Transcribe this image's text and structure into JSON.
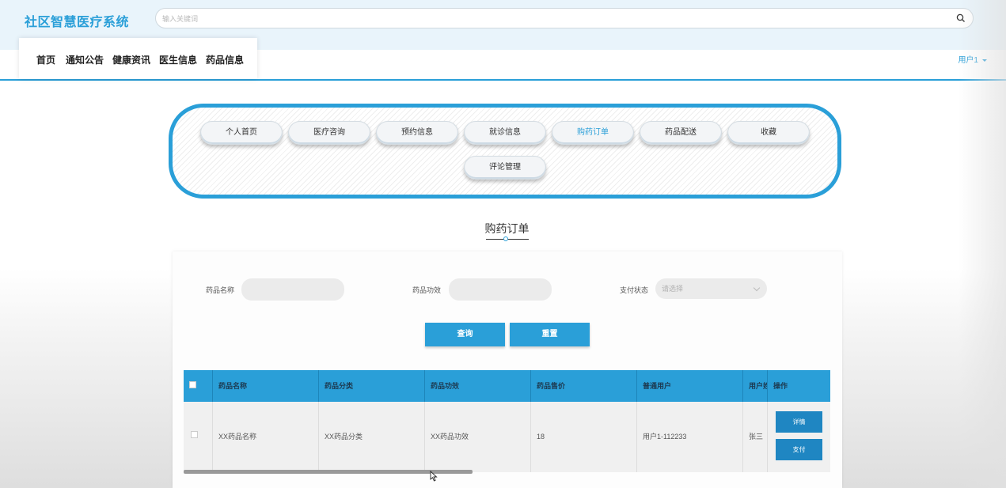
{
  "header": {
    "logo": "社区智慧医疗系统",
    "search_placeholder": "输入关键词"
  },
  "nav": {
    "items": [
      "首页",
      "通知公告",
      "健康资讯",
      "医生信息",
      "药品信息"
    ],
    "user": "用户1"
  },
  "menu": {
    "items": [
      "个人首页",
      "医疗咨询",
      "预约信息",
      "就诊信息",
      "购药订单",
      "药品配送",
      "收藏",
      "评论管理"
    ],
    "active": "购药订单"
  },
  "section_title": "购药订单",
  "filters": {
    "name_label": "药品名称",
    "effect_label": "药品功效",
    "pay_label": "支付状态",
    "pay_placeholder": "请选择",
    "search_button": "查询",
    "reset_button": "重置"
  },
  "table": {
    "columns": [
      "药品名称",
      "药品分类",
      "药品功效",
      "药品售价",
      "普通用户",
      "用户姓名",
      "操作"
    ],
    "rows": [
      {
        "name": "XX药品名称",
        "category": "XX药品分类",
        "effect": "XX药品功效",
        "price": "18",
        "user": "用户1-112233",
        "username": "张三"
      }
    ],
    "actions": [
      "详情",
      "支付"
    ]
  },
  "colors": {
    "accent": "#2a9fd8"
  }
}
